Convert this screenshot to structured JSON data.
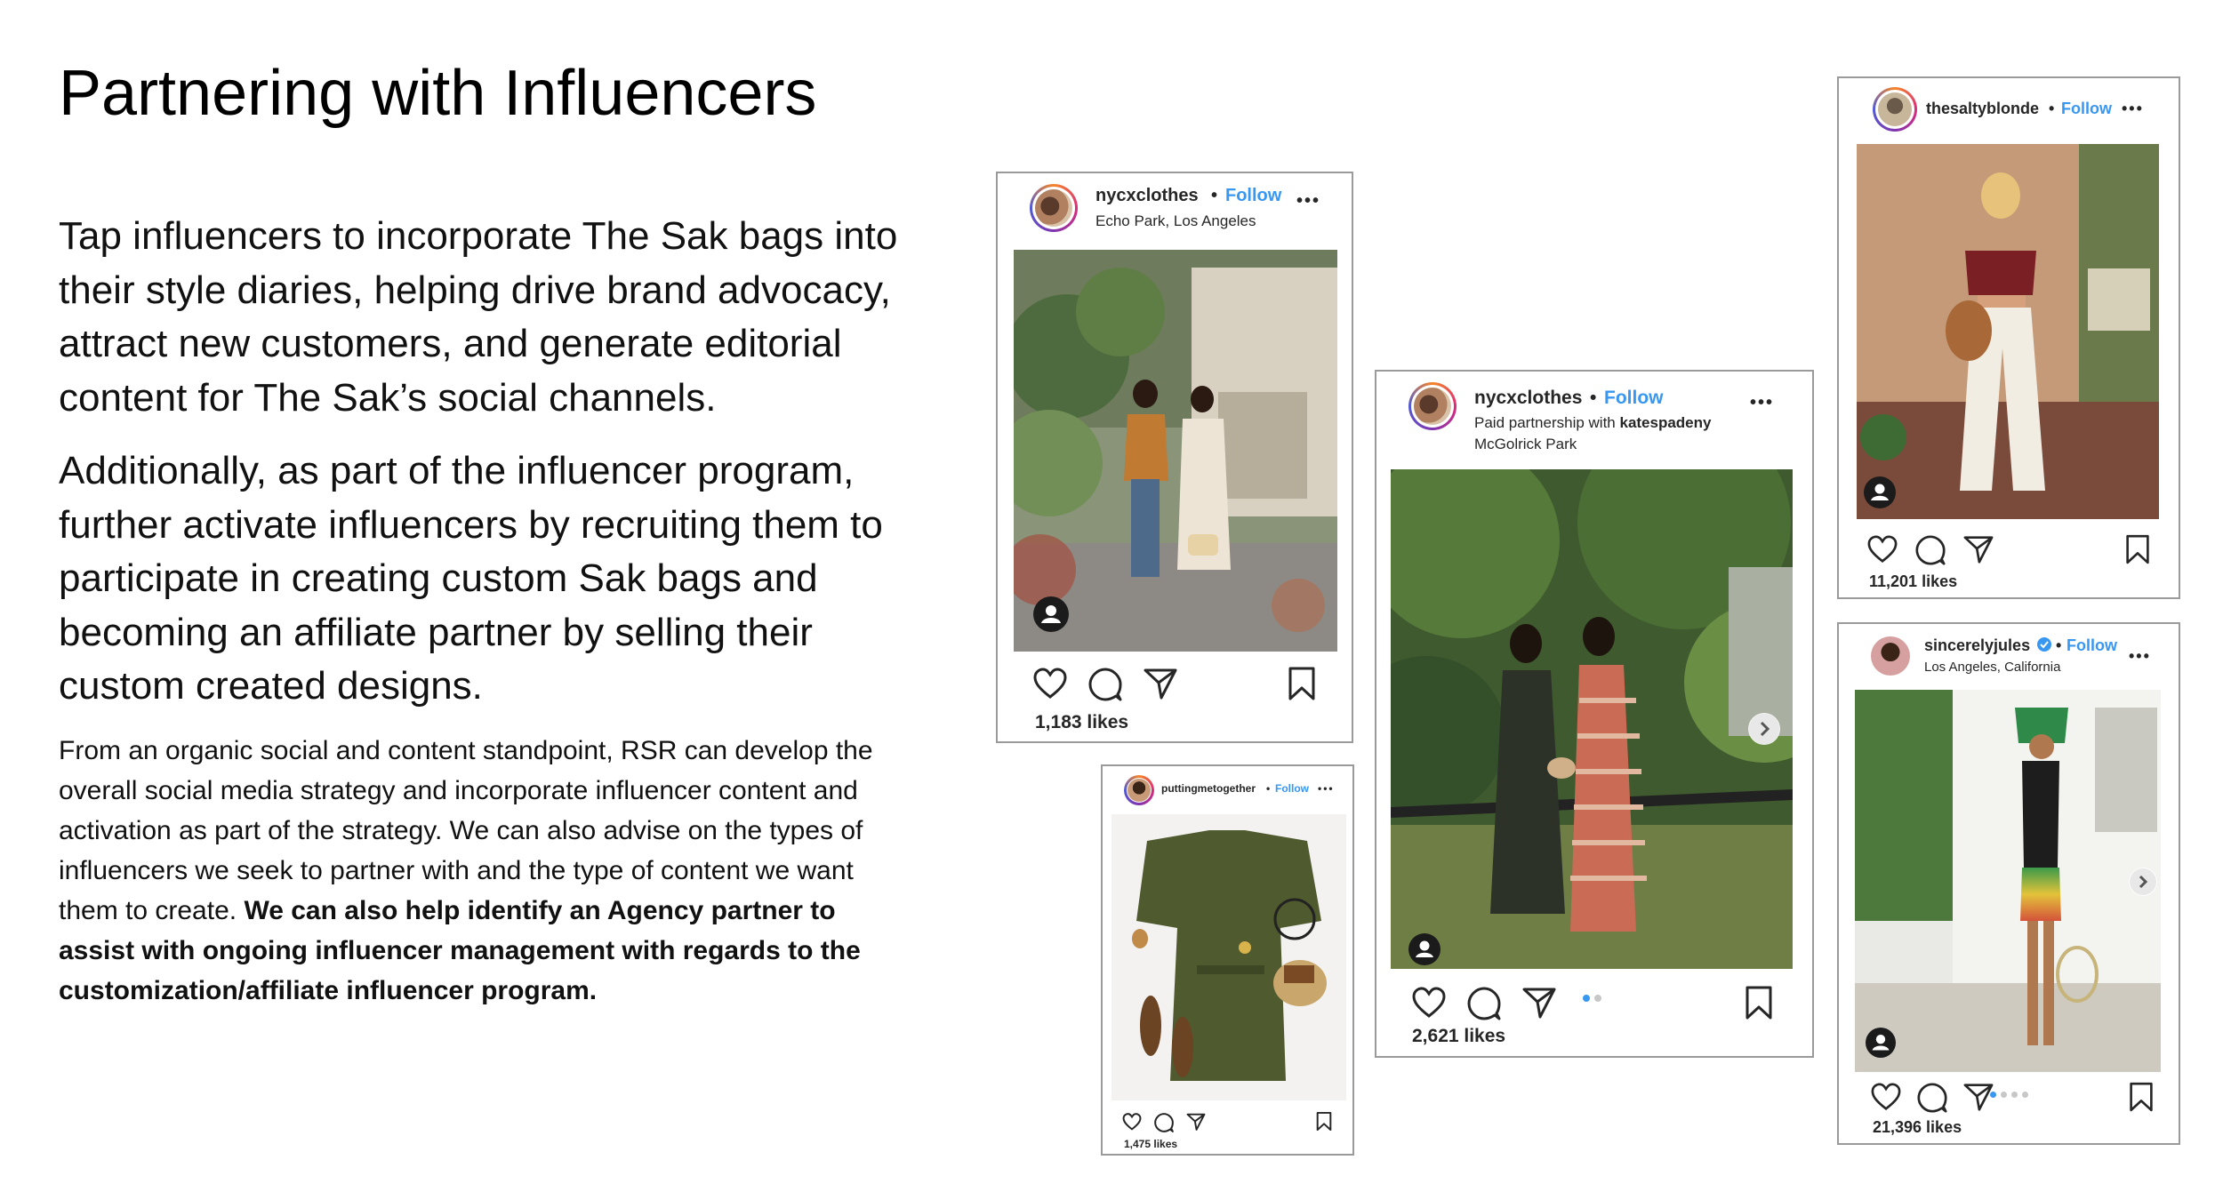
{
  "slide": {
    "title": "Partnering with Influencers",
    "lead_1": "Tap influencers to incorporate The Sak bags into their style diaries, helping drive brand advocacy, attract new customers, and generate editorial content for The Sak’s social channels.",
    "lead_2": "Additionally, as part of the influencer program, further activate influencers by recruiting them to participate in creating custom Sak bags and becoming an affiliate partner by selling their custom created designs.",
    "body_regular": "From an organic social and content standpoint, RSR can develop the overall social media strategy and incorporate influencer content and activation as part of the strategy. We can also advise on the types of influencers we seek to partner with and the type of content we want them to create. ",
    "body_bold": "We can also help identify an Agency partner to assist with ongoing influencer management with regards to the customization/affiliate influencer program."
  },
  "posts": {
    "p1": {
      "username": "nycxclothes",
      "follow": "Follow",
      "location": "Echo Park, Los Angeles",
      "likes": "1,183 likes"
    },
    "p2": {
      "username": "puttingmetogether",
      "follow": "Follow",
      "likes": "1,475 likes"
    },
    "p3": {
      "username": "nycxclothes",
      "follow": "Follow",
      "partnership_prefix": "Paid partnership with ",
      "partner": "katespadeny",
      "location": "McGolrick Park",
      "likes": "2,621 likes"
    },
    "p4": {
      "username": "thesaltyblonde",
      "follow": "Follow",
      "likes": "11,201 likes"
    },
    "p5": {
      "username": "sincerelyjules",
      "follow": "Follow",
      "location": "Los Angeles, California",
      "likes": "21,396 likes"
    }
  },
  "icons": [
    "heart-icon",
    "comment-icon",
    "share-icon",
    "bookmark-icon",
    "user-tag-icon",
    "chevron-right-icon",
    "verified-icon",
    "more-icon"
  ],
  "colors": {
    "follow_blue": "#3897f0",
    "card_border": "#9a9a9a",
    "text": "#262626"
  }
}
